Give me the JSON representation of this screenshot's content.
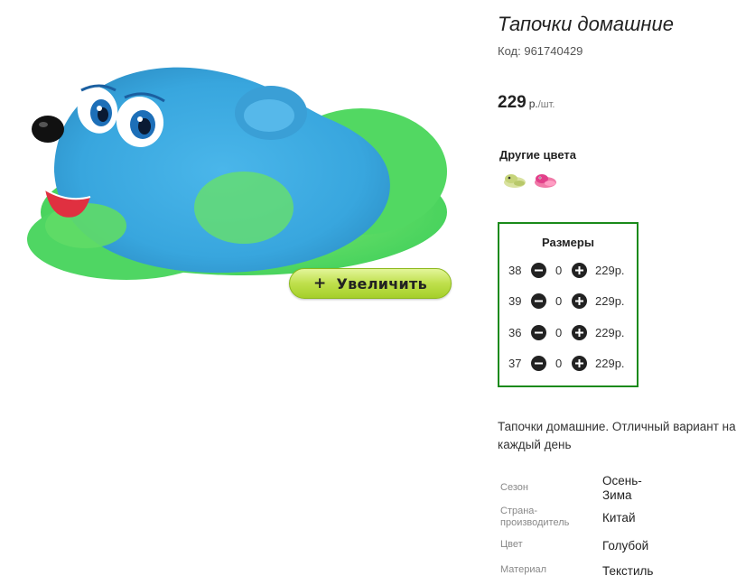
{
  "product": {
    "title": "Тапочки домашние",
    "code_label": "Код:",
    "code": "961740429",
    "price": "229",
    "currency": "р.",
    "unit": "/шт."
  },
  "zoom_button": {
    "plus": "+",
    "label": "Увеличить"
  },
  "other_colors": {
    "title": "Другие цвета",
    "items": [
      {
        "color": "#c9d98a"
      },
      {
        "color": "#e2408a"
      }
    ]
  },
  "sizes": {
    "title": "Размеры",
    "rows": [
      {
        "size": "38",
        "qty": "0",
        "price": "229р."
      },
      {
        "size": "39",
        "qty": "0",
        "price": "229р."
      },
      {
        "size": "36",
        "qty": "0",
        "price": "229р."
      },
      {
        "size": "37",
        "qty": "0",
        "price": "229р."
      }
    ]
  },
  "description": "Тапочки домашние. Отличный вариант на каждый день",
  "properties": [
    {
      "key": "Сезон",
      "value": "Осень-\nЗима"
    },
    {
      "key": "Страна-\nпроизводитель",
      "value": "Китай"
    },
    {
      "key": "Цвет",
      "value": "Голубой"
    },
    {
      "key": "Материал",
      "value": "Текстиль"
    }
  ],
  "colors": {
    "frame_green": "#1a8a1a",
    "button_green": "#bfe04c",
    "slipper_blue": "#3aa8e0",
    "fur_green": "#5ee05a"
  }
}
